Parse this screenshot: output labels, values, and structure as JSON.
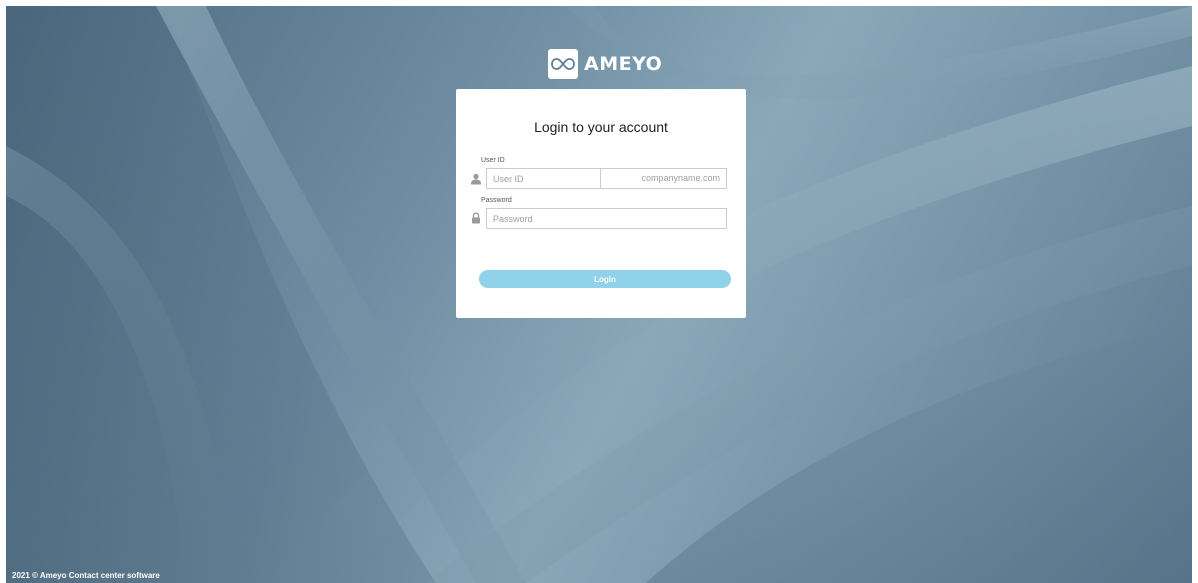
{
  "brand": {
    "name": "AMEYO",
    "logo_icon": "infinity-icon"
  },
  "login": {
    "title": "Login to your account",
    "user_id_label": "User ID",
    "user_id_placeholder": "User ID",
    "user_icon": "user-icon",
    "domain_suffix": "companyname.com",
    "password_label": "Password",
    "password_placeholder": "Password",
    "password_icon": "lock-icon",
    "button_label": "Login"
  },
  "footer": {
    "text": "2021 © Ameyo Contact center software"
  },
  "colors": {
    "background": "#6f8ea3",
    "button": "#8fd2ea",
    "card": "#ffffff"
  }
}
